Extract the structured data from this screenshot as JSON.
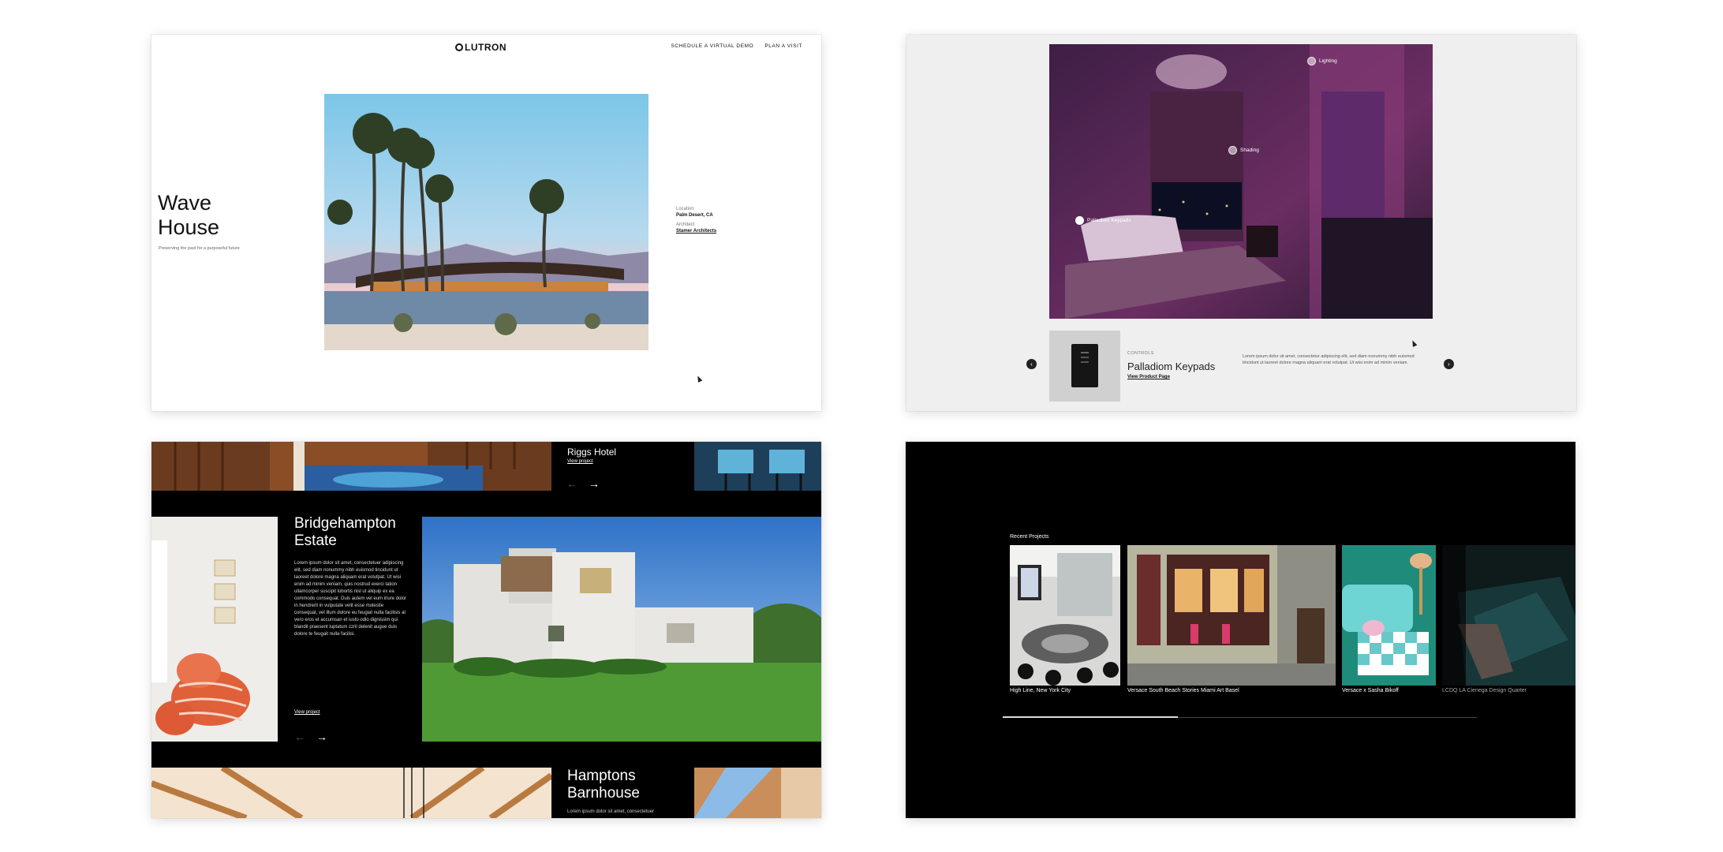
{
  "panel1": {
    "logo": "LUTRON",
    "nav": [
      "SCHEDULE A VIRTUAL DEMO",
      "PLAN A VISIT"
    ],
    "title_line1": "Wave",
    "title_line2": "House",
    "subtitle": "Preserving the past for a purposeful future",
    "location_label": "Location",
    "location_value": "Palm Desert, CA",
    "architect_label": "Architect",
    "architect_value": "Stamer Architects"
  },
  "panel2": {
    "hotspots": [
      "Lighting",
      "Shading",
      "Palladiom Keypads"
    ],
    "controls_label": "CONTROLS",
    "product_name": "Palladiom Keypads",
    "product_link": "View Product Page",
    "description": "Lorem ipsum dolor sit amet, consectetur adipiscing elit, sed diam nonummy nibh euismod tincidunt ut laoreet dolore magna aliquam erat volutpat. Ut wisi enim ad minim veniam.",
    "prev_icon": "‹",
    "next_icon": "›"
  },
  "panel3": {
    "top_project": "Riggs Hotel",
    "top_link": "View project",
    "main_project_line1": "Bridgehampton",
    "main_project_line2": "Estate",
    "main_body": "Lorem ipsum dolor sit amet, consectetuer adipiscing elit, sed diam nonummy nibh euismod tincidunt ut laoreet dolore magna aliquam erat volutpat. Ut wisi enim ad minim veniam, quis nostrud exerci tation ullamcorper suscipit lobortis nisl ut aliquip ex ea commodo consequat. Duis autem vel eum iriure dolor in hendrerit in vulputate velit esse molestie consequat, vel illum dolore eu feugiat nulla facilisis at vero eros et accumsan et iusto odio dignissim qui blandit praesent luptatum zzril delenit augue duis dolore te feugait nulla facilisi.",
    "main_link": "View project",
    "bottom_project_line1": "Hamptons",
    "bottom_project_line2": "Barnhouse",
    "bottom_body": "Lorem ipsum dolor sit amet, consectetuer",
    "arrow_left": "←",
    "arrow_right": "→"
  },
  "panel4": {
    "title": "Recent Projects",
    "captions": [
      "High Line, New York City",
      "Versace South Beach Stories Miami Art Basel",
      "Versace x Sasha Bikoff",
      "LCDQ LA Cienega Design Quarter"
    ],
    "progress": 0.37
  }
}
